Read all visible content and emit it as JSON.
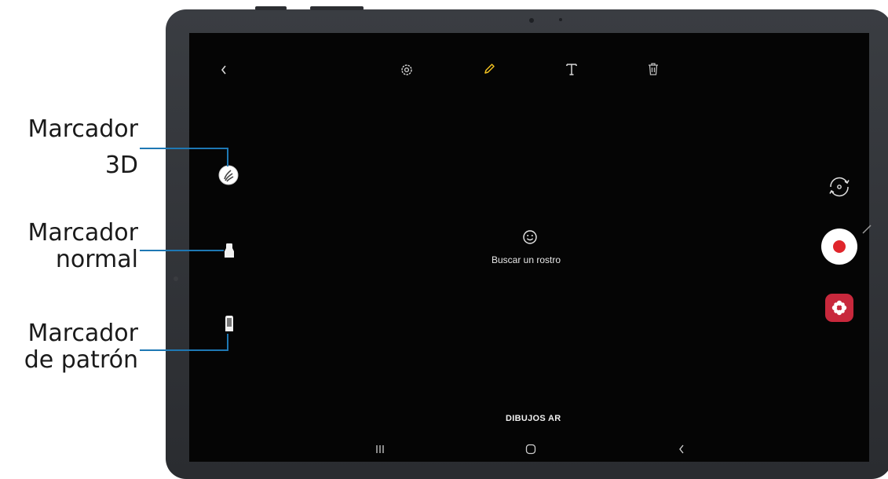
{
  "callouts": [
    {
      "line1": "Marcador",
      "line2": "3D"
    },
    {
      "line1": "Marcador",
      "line2": "normal"
    },
    {
      "line1": "Marcador",
      "line2": "de patrón"
    }
  ],
  "toolbar": {
    "icons": [
      "back-icon",
      "settings-icon",
      "pencil-icon",
      "text-icon",
      "trash-icon"
    ],
    "active_color": "#f0c020"
  },
  "main": {
    "status_text": "Buscar un rostro",
    "mode_label": "DIBUJOS AR"
  },
  "side_controls": {
    "record_color": "#e0252b",
    "sticker_bg": "#c8283c"
  },
  "nav_bar": [
    "recents-icon",
    "home-icon",
    "back-icon"
  ]
}
